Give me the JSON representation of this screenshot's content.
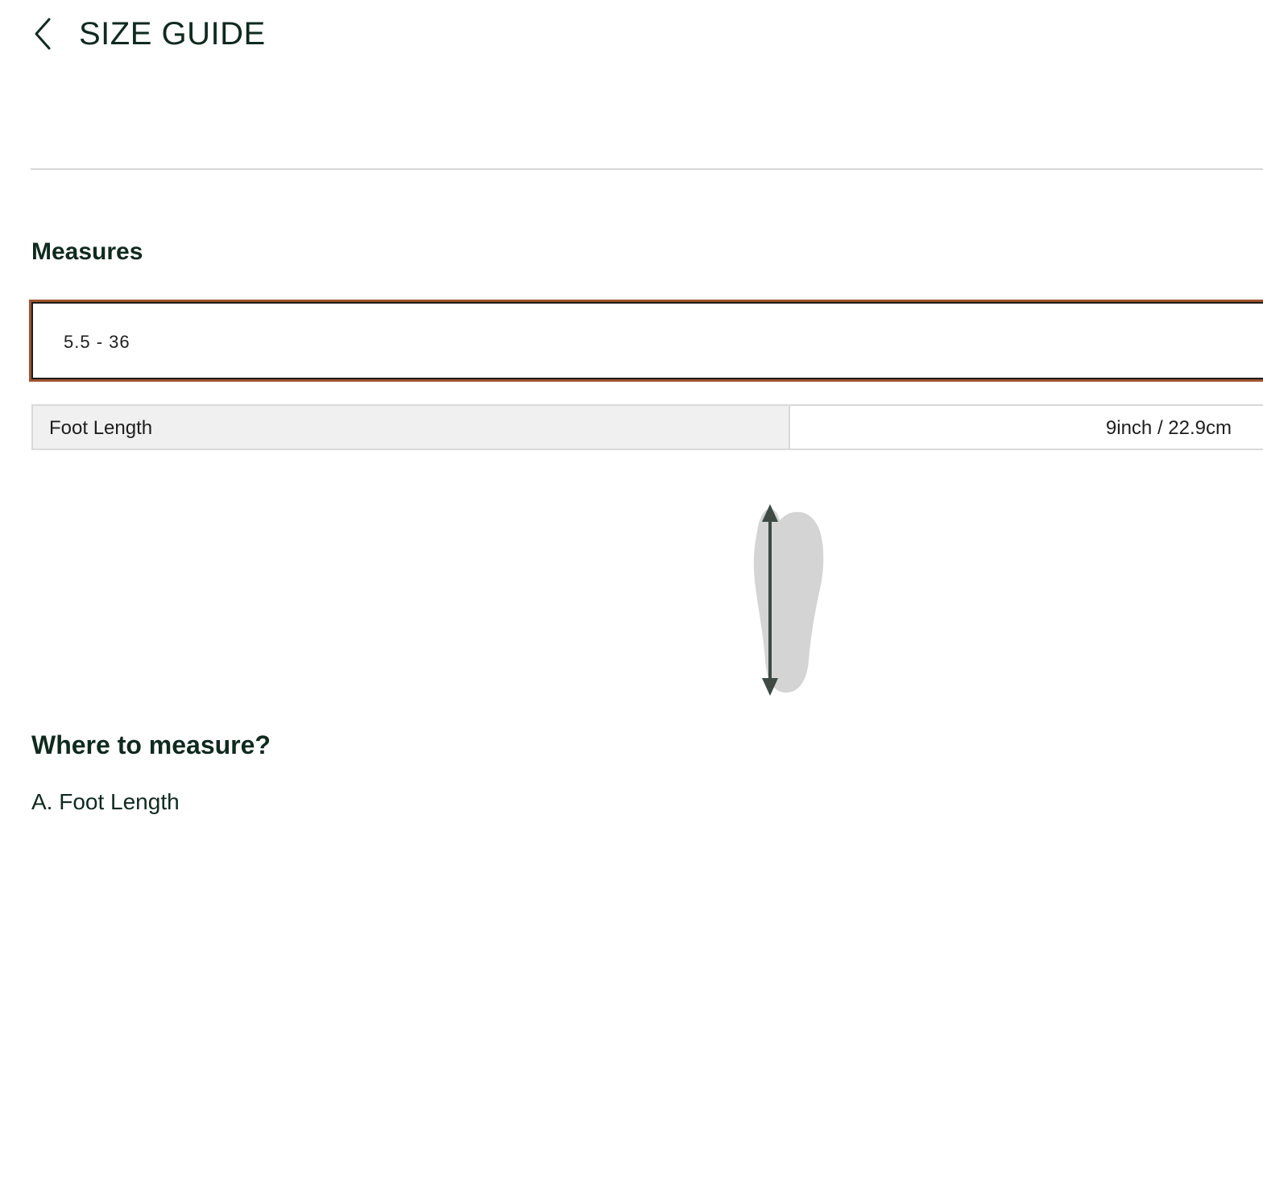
{
  "header": {
    "title": "SIZE GUIDE",
    "back_icon": "chevron-left-icon"
  },
  "measures": {
    "heading": "Measures",
    "selected_size": "5.5 - 36",
    "accent_color": "#a0522d",
    "rows": [
      {
        "label": "Foot Length",
        "value": "9inch / 22.9cm"
      }
    ]
  },
  "diagram": {
    "icon": "foot-length-diagram"
  },
  "where": {
    "heading": "Where to measure?",
    "items": [
      "A. Foot Length"
    ]
  }
}
